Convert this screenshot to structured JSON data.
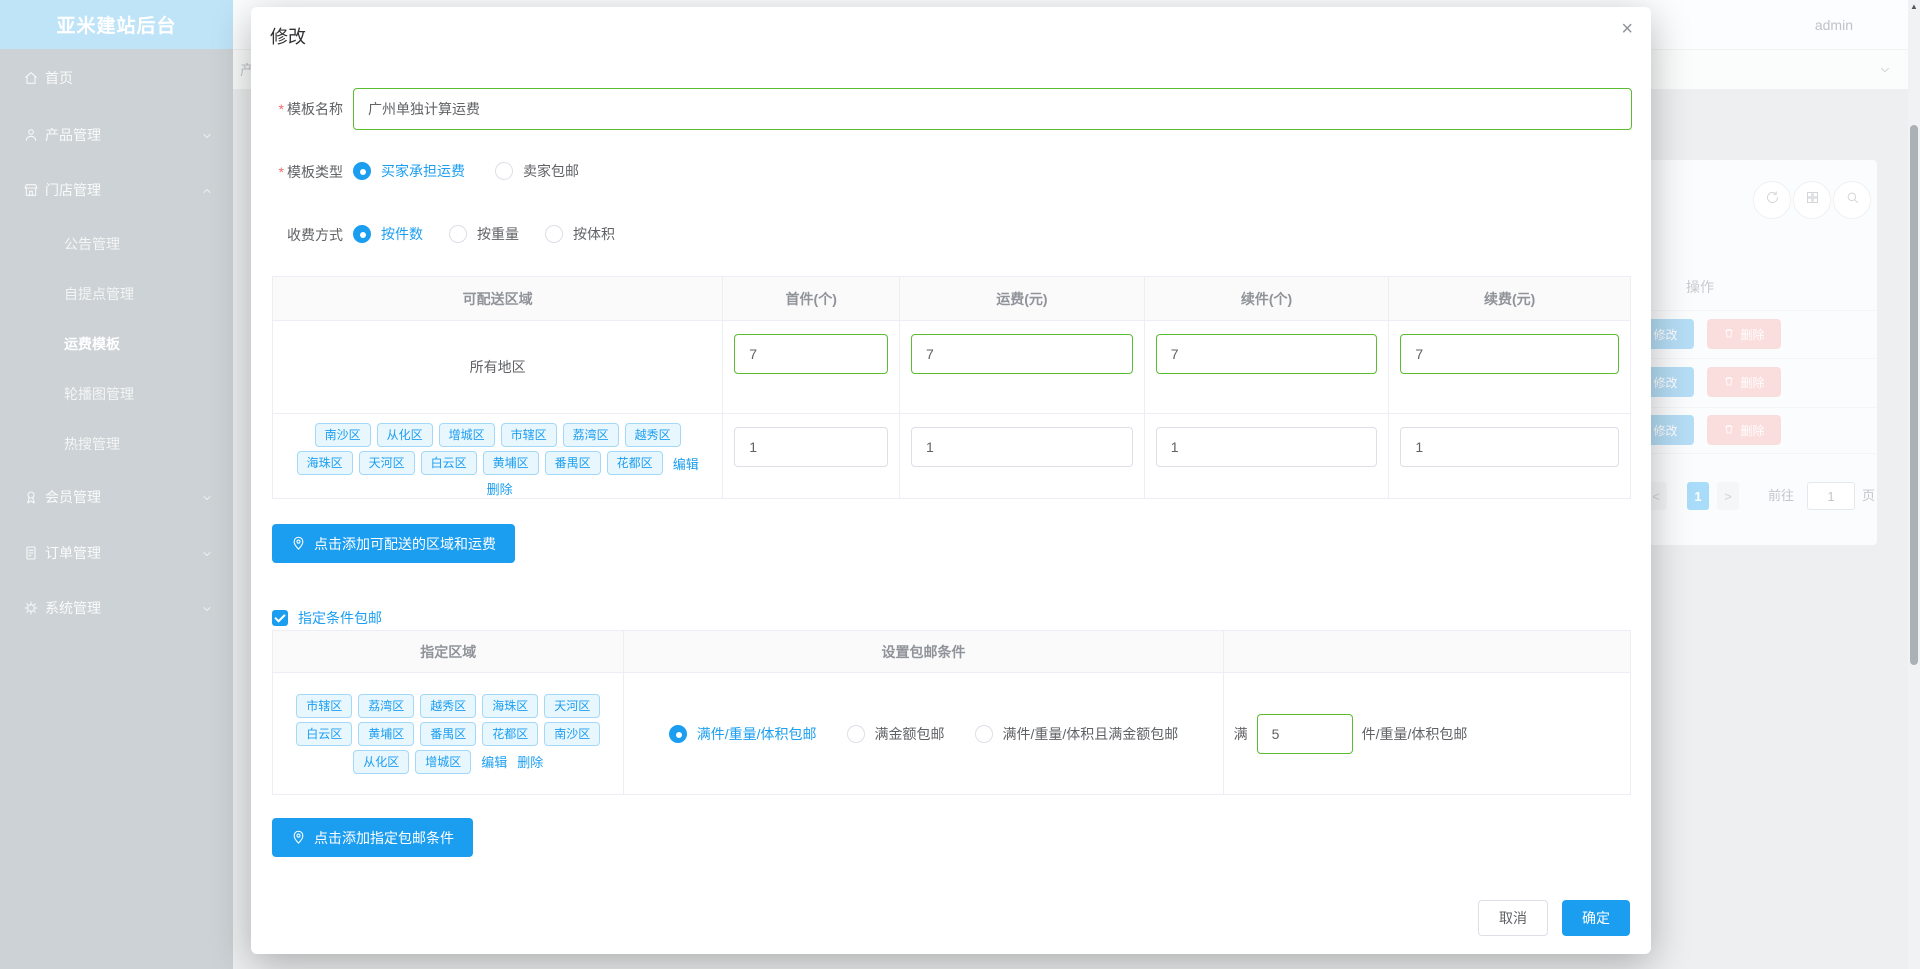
{
  "colors": {
    "accent": "#1c9ef0",
    "success_green": "#5abc30",
    "danger_red": "#f56c6c",
    "tag_bg": "#e8f6fe",
    "tag_border": "#a3d9f8"
  },
  "icons": {
    "close": "×",
    "scroll_up": "▲",
    "prev_page": "<",
    "next_page": ">"
  },
  "topbar": {
    "username": "admin",
    "background_tab": "产"
  },
  "sidebar": {
    "title": "亚米建站后台",
    "items": [
      {
        "label": "首页"
      },
      {
        "label": "产品管理"
      },
      {
        "label": "门店管理"
      },
      {
        "label": "会员管理"
      },
      {
        "label": "订单管理"
      },
      {
        "label": "系统管理"
      }
    ],
    "store_children": [
      "公告管理",
      "自提点管理",
      "运费模板",
      "轮播图管理",
      "热搜管理"
    ],
    "active_item": "运费模板"
  },
  "background_table": {
    "ops_header": "操作",
    "edit_label": "修改",
    "delete_label": "删除",
    "pagination": {
      "active_page": "1",
      "goto": "前往",
      "page_input": "1",
      "unit": "页"
    }
  },
  "modal": {
    "title": "修改",
    "name_field": {
      "label": "模板名称",
      "value": "广州单独计算运费"
    },
    "type_field": {
      "label": "模板类型",
      "options": [
        "买家承担运费",
        "卖家包邮"
      ],
      "selected": "买家承担运费"
    },
    "charge_field": {
      "label": "收费方式",
      "options": [
        "按件数",
        "按重量",
        "按体积"
      ],
      "selected": "按件数"
    },
    "area_table": {
      "headers": [
        "可配送区域",
        "首件(个)",
        "运费(元)",
        "续件(个)",
        "续费(元)"
      ],
      "row_all": {
        "area": "所有地区",
        "first_count": "7",
        "first_fee": "7",
        "next_count": "7",
        "next_fee": "7"
      },
      "row_districts": {
        "tags": [
          "南沙区",
          "从化区",
          "增城区",
          "市辖区",
          "荔湾区",
          "越秀区",
          "海珠区",
          "天河区",
          "白云区",
          "黄埔区",
          "番禺区",
          "花都区"
        ],
        "edit": "编辑",
        "delete": "删除",
        "first_count": "1",
        "first_fee": "1",
        "next_count": "1",
        "next_fee": "1"
      }
    },
    "add_area_button": "点击添加可配送的区域和运费",
    "conditional_free": {
      "checkbox_label": "指定条件包邮",
      "checked": true,
      "headers": [
        "指定区域",
        "设置包邮条件"
      ],
      "tags": [
        "市辖区",
        "荔湾区",
        "越秀区",
        "海珠区",
        "天河区",
        "白云区",
        "黄埔区",
        "番禺区",
        "花都区",
        "南沙区",
        "从化区",
        "增城区"
      ],
      "edit": "编辑",
      "delete": "删除",
      "options": [
        "满件/重量/体积包邮",
        "满金额包邮",
        "满件/重量/体积且满金额包邮"
      ],
      "selected": "满件/重量/体积包邮",
      "threshold_prefix": "满",
      "threshold_value": "5",
      "threshold_suffix": "件/重量/体积包邮"
    },
    "add_condition_button": "点击添加指定包邮条件",
    "cancel": "取消",
    "confirm": "确定"
  }
}
